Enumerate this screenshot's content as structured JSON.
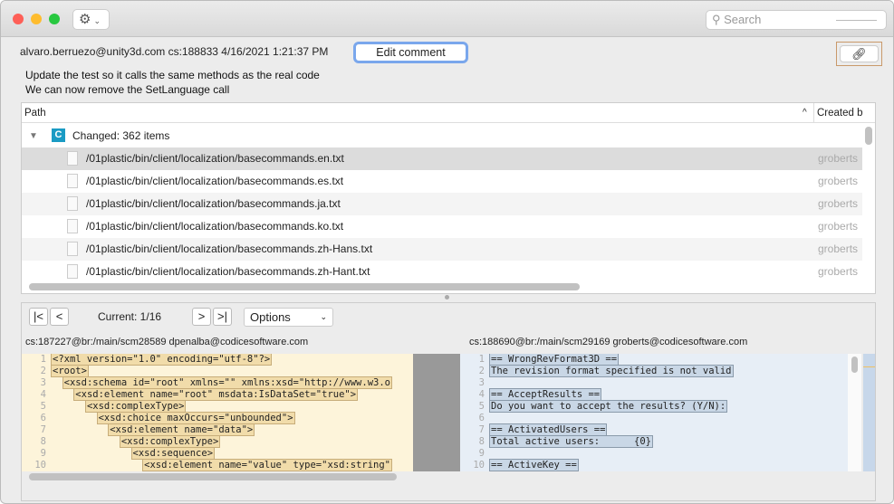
{
  "toolbar": {
    "search_placeholder": "Search",
    "gear_icon": "gear-icon"
  },
  "changeset": {
    "info": "alvaro.berruezo@unity3d.com cs:188833 4/16/2021 1:21:37 PM",
    "edit_comment": "Edit comment",
    "comment_lines": [
      "Update the test so it calls the same methods as the real code",
      "We can now remove the SetLanguage call"
    ]
  },
  "table": {
    "columns": [
      "Path",
      "Created b"
    ],
    "group": {
      "badge": "C",
      "label": "Changed: 362 items"
    },
    "rows": [
      {
        "path": "/01plastic/bin/client/localization/basecommands.en.txt",
        "owner": "groberts"
      },
      {
        "path": "/01plastic/bin/client/localization/basecommands.es.txt",
        "owner": "groberts"
      },
      {
        "path": "/01plastic/bin/client/localization/basecommands.ja.txt",
        "owner": "groberts"
      },
      {
        "path": "/01plastic/bin/client/localization/basecommands.ko.txt",
        "owner": "groberts"
      },
      {
        "path": "/01plastic/bin/client/localization/basecommands.zh-Hans.txt",
        "owner": "groberts"
      },
      {
        "path": "/01plastic/bin/client/localization/basecommands.zh-Hant.txt",
        "owner": "groberts"
      }
    ]
  },
  "diff": {
    "current": "Current: 1/16",
    "options": "Options",
    "left_cs": "cs:187227@br:/main/scm28589 dpenalba@codicesoftware.com",
    "right_cs": "cs:188690@br:/main/scm29169 groberts@codicesoftware.com",
    "left_lines": [
      "<?xml version=\"1.0\" encoding=\"utf-8\"?>",
      "<root>",
      "  <xsd:schema id=\"root\" xmlns=\"\" xmlns:xsd=\"http://www.w3.o",
      "    <xsd:element name=\"root\" msdata:IsDataSet=\"true\">",
      "      <xsd:complexType>",
      "        <xsd:choice maxOccurs=\"unbounded\">",
      "          <xsd:element name=\"data\">",
      "            <xsd:complexType>",
      "              <xsd:sequence>",
      "                <xsd:element name=\"value\" type=\"xsd:string\""
    ],
    "right_lines": [
      "== WrongRevFormat3D ==",
      "The revision format specified is not valid",
      "",
      "== AcceptResults ==",
      "Do you want to accept the results? (Y/N):",
      "",
      "== ActivatedUsers ==",
      "Total active users:      {0}",
      "",
      "== ActiveKey =="
    ]
  }
}
